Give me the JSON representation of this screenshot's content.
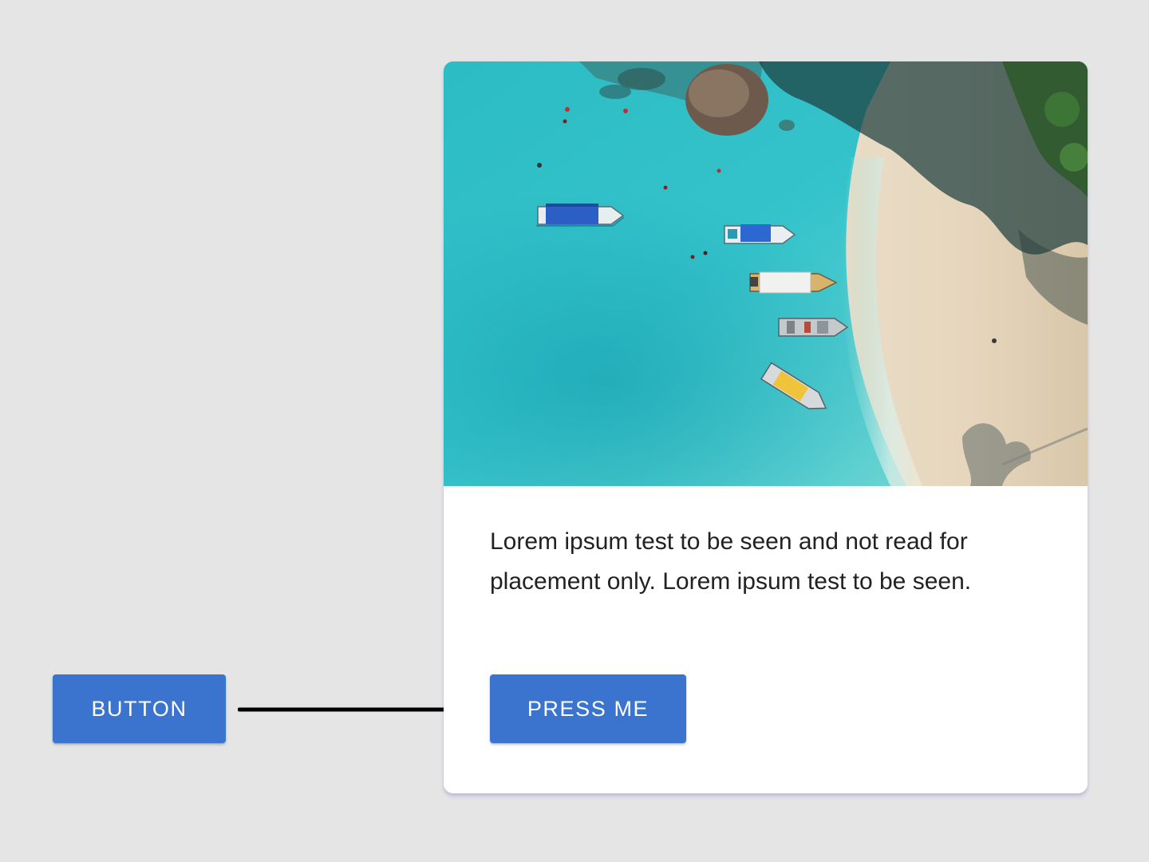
{
  "left_button": {
    "label": "BUTTON"
  },
  "card": {
    "image_alt": "Aerial view of boats anchored in turquoise water beside a sandy beach",
    "body_text": "Lorem ipsum test to be seen and not read for placement only. Lorem ipsum test to be seen.",
    "button_label": "PRESS ME"
  },
  "colors": {
    "background": "#e5e5e6",
    "button": "#3a74cf",
    "button_text": "#ffffff",
    "card": "#ffffff",
    "body_text": "#222222",
    "arrow": "#000000"
  },
  "icons": {
    "arrow": "arrow-right-icon"
  }
}
